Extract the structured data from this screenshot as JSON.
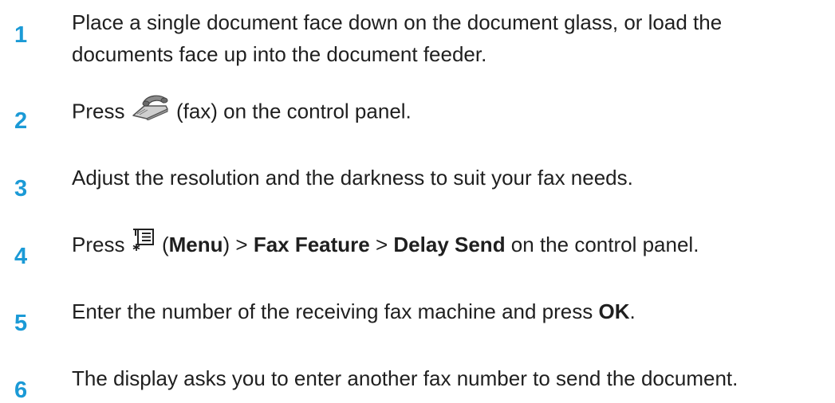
{
  "steps": [
    {
      "number": "1",
      "line1": "Place a single document face down on the document glass, or load the",
      "line2": "documents face up into the document feeder."
    },
    {
      "number": "2",
      "prefix": "Press",
      "icon": "fax-icon",
      "suffix": "(fax) on the control panel."
    },
    {
      "number": "3",
      "text": "Adjust the resolution and the darkness to suit your fax needs."
    },
    {
      "number": "4",
      "prefix": "Press",
      "icon": "menu-icon",
      "paren_open": "(",
      "menu": "Menu",
      "paren_close": ")",
      "sep1": " > ",
      "fax_feature": "Fax Feature",
      "sep2": " > ",
      "delay_send": "Delay Send",
      "suffix": " on the control panel."
    },
    {
      "number": "5",
      "text": "Enter the number of the receiving fax machine and press ",
      "ok": "OK",
      "period": "."
    },
    {
      "number": "6",
      "text": "The display asks you to enter another fax number to send the document."
    }
  ],
  "colors": {
    "step_number": "#1b9ad6",
    "body_text": "#1f1f1f"
  }
}
